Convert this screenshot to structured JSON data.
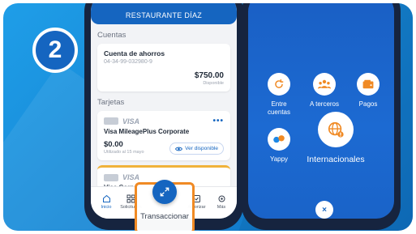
{
  "step_number": "2",
  "phone1": {
    "bank_name": "RESTAURANTE DÍAZ",
    "accounts_section": "Cuentas",
    "account": {
      "name": "Cuenta de ahorros",
      "number": "04-34-99-032980-9",
      "balance": "$750.00",
      "status": "Disponible"
    },
    "cards_section": "Tarjetas",
    "card": {
      "brand": "VISA",
      "name": "Visa MileagePlus Corporate",
      "amount": "$0.00",
      "used_label": "Utilizado al 15 mayo",
      "view_button": "Ver disponible",
      "menu": "•••"
    },
    "card2": {
      "brand": "VISA",
      "name": "Visa Corp"
    },
    "nav": {
      "home": "Inicio",
      "requests": "Solicitudes",
      "transact": "Transaccionar",
      "authorize": "Autorizar",
      "more": "Más"
    }
  },
  "phone2": {
    "options": {
      "between_accounts": "Entre\ncuentas",
      "third_parties": "A terceros",
      "payments": "Pagos",
      "yappy": "Yappy",
      "international": "Internacionales"
    },
    "close": "×"
  },
  "colors": {
    "primary_blue": "#1565c0",
    "highlight_orange": "#f08a24",
    "payments_orange": "#f08a24"
  }
}
